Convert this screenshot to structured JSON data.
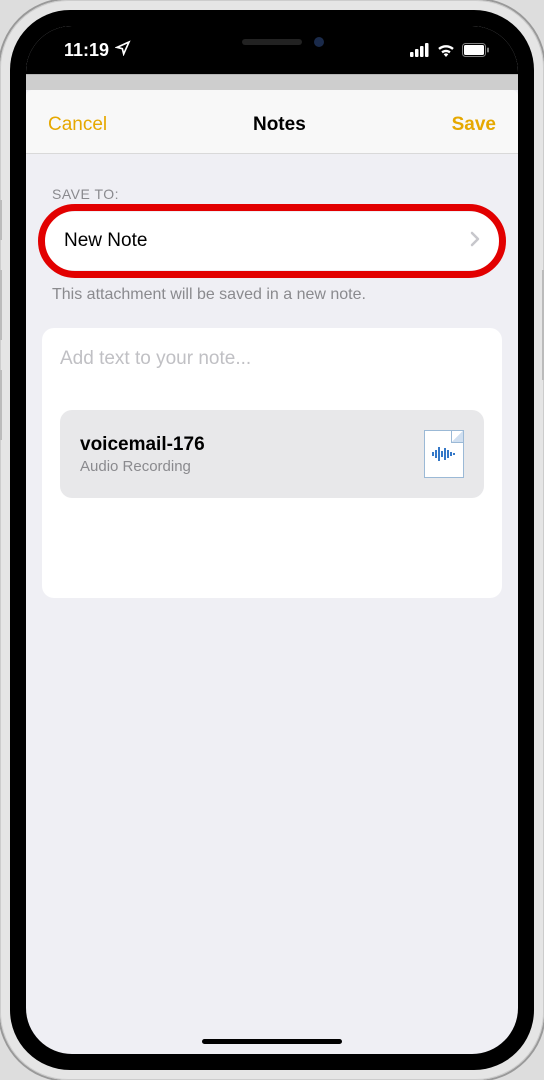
{
  "status": {
    "time": "11:19",
    "location_icon": "location-arrow-icon",
    "signal_icon": "cellular-signal-icon",
    "wifi_icon": "wifi-icon",
    "battery_icon": "battery-full-icon"
  },
  "nav": {
    "cancel": "Cancel",
    "title": "Notes",
    "save": "Save"
  },
  "save_to": {
    "header": "SAVE TO:",
    "destination": "New Note",
    "hint": "This attachment will be saved in a new note."
  },
  "note": {
    "placeholder": "Add text to your note...",
    "attachment": {
      "name": "voicemail-176",
      "type": "Audio Recording",
      "icon": "audio-file-icon"
    }
  },
  "colors": {
    "accent": "#e6a800",
    "highlight_ring": "#e20000"
  }
}
